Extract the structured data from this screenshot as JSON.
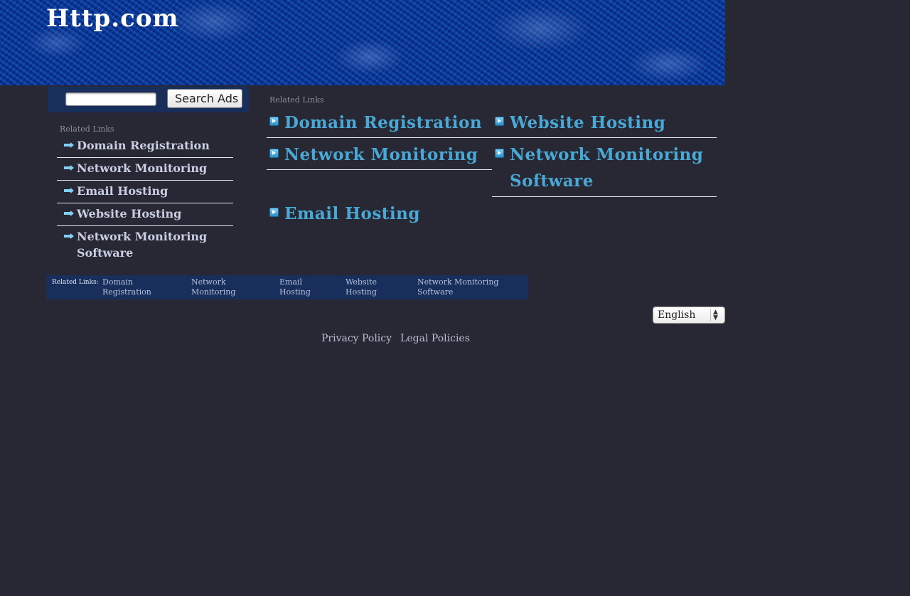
{
  "site": {
    "title": "Http.com"
  },
  "search": {
    "placeholder": "",
    "value": "",
    "button_label": "Search Ads"
  },
  "sidebar": {
    "heading": "Related Links",
    "items": [
      {
        "label": "Domain Registration"
      },
      {
        "label": "Network Monitoring"
      },
      {
        "label": "Email Hosting"
      },
      {
        "label": "Website Hosting"
      },
      {
        "label": "Network Monitoring Software"
      }
    ]
  },
  "main": {
    "heading": "Related Links",
    "links": [
      {
        "label": "Domain Registration"
      },
      {
        "label": "Website Hosting"
      },
      {
        "label": "Network Monitoring"
      },
      {
        "label": "Network Monitoring Software"
      },
      {
        "label": "Email Hosting"
      }
    ]
  },
  "footer_bar": {
    "label": "Related Links:",
    "links": [
      {
        "label": "Domain Registration"
      },
      {
        "label": "Network Monitoring"
      },
      {
        "label": "Email Hosting"
      },
      {
        "label": "Website Hosting"
      },
      {
        "label": "Network Monitoring Software"
      }
    ]
  },
  "language": {
    "selected": "English"
  },
  "policies": {
    "privacy": "Privacy Policy",
    "legal": "Legal Policies"
  },
  "colors": {
    "background": "#282734",
    "banner": "#0b3488",
    "search_bar": "#182f5c",
    "link_accent": "#4aa8d4",
    "sidebar_link": "#c9cfe3"
  }
}
